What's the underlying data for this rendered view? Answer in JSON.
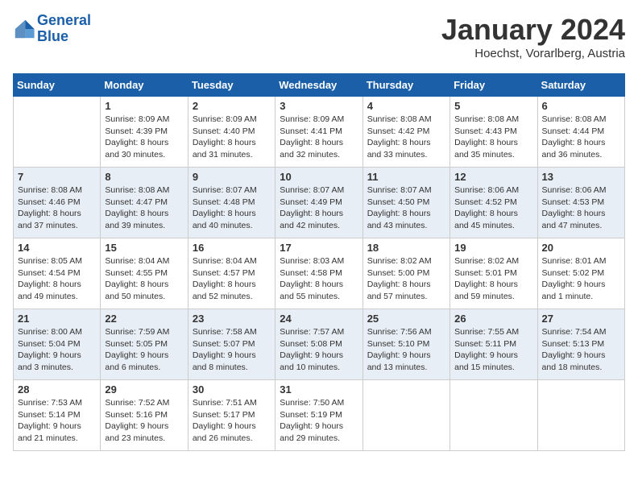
{
  "header": {
    "logo_line1": "General",
    "logo_line2": "Blue",
    "month": "January 2024",
    "location": "Hoechst, Vorarlberg, Austria"
  },
  "days_of_week": [
    "Sunday",
    "Monday",
    "Tuesday",
    "Wednesday",
    "Thursday",
    "Friday",
    "Saturday"
  ],
  "weeks": [
    [
      {
        "day": "",
        "info": ""
      },
      {
        "day": "1",
        "info": "Sunrise: 8:09 AM\nSunset: 4:39 PM\nDaylight: 8 hours\nand 30 minutes."
      },
      {
        "day": "2",
        "info": "Sunrise: 8:09 AM\nSunset: 4:40 PM\nDaylight: 8 hours\nand 31 minutes."
      },
      {
        "day": "3",
        "info": "Sunrise: 8:09 AM\nSunset: 4:41 PM\nDaylight: 8 hours\nand 32 minutes."
      },
      {
        "day": "4",
        "info": "Sunrise: 8:08 AM\nSunset: 4:42 PM\nDaylight: 8 hours\nand 33 minutes."
      },
      {
        "day": "5",
        "info": "Sunrise: 8:08 AM\nSunset: 4:43 PM\nDaylight: 8 hours\nand 35 minutes."
      },
      {
        "day": "6",
        "info": "Sunrise: 8:08 AM\nSunset: 4:44 PM\nDaylight: 8 hours\nand 36 minutes."
      }
    ],
    [
      {
        "day": "7",
        "info": "Sunrise: 8:08 AM\nSunset: 4:46 PM\nDaylight: 8 hours\nand 37 minutes."
      },
      {
        "day": "8",
        "info": "Sunrise: 8:08 AM\nSunset: 4:47 PM\nDaylight: 8 hours\nand 39 minutes."
      },
      {
        "day": "9",
        "info": "Sunrise: 8:07 AM\nSunset: 4:48 PM\nDaylight: 8 hours\nand 40 minutes."
      },
      {
        "day": "10",
        "info": "Sunrise: 8:07 AM\nSunset: 4:49 PM\nDaylight: 8 hours\nand 42 minutes."
      },
      {
        "day": "11",
        "info": "Sunrise: 8:07 AM\nSunset: 4:50 PM\nDaylight: 8 hours\nand 43 minutes."
      },
      {
        "day": "12",
        "info": "Sunrise: 8:06 AM\nSunset: 4:52 PM\nDaylight: 8 hours\nand 45 minutes."
      },
      {
        "day": "13",
        "info": "Sunrise: 8:06 AM\nSunset: 4:53 PM\nDaylight: 8 hours\nand 47 minutes."
      }
    ],
    [
      {
        "day": "14",
        "info": "Sunrise: 8:05 AM\nSunset: 4:54 PM\nDaylight: 8 hours\nand 49 minutes."
      },
      {
        "day": "15",
        "info": "Sunrise: 8:04 AM\nSunset: 4:55 PM\nDaylight: 8 hours\nand 50 minutes."
      },
      {
        "day": "16",
        "info": "Sunrise: 8:04 AM\nSunset: 4:57 PM\nDaylight: 8 hours\nand 52 minutes."
      },
      {
        "day": "17",
        "info": "Sunrise: 8:03 AM\nSunset: 4:58 PM\nDaylight: 8 hours\nand 55 minutes."
      },
      {
        "day": "18",
        "info": "Sunrise: 8:02 AM\nSunset: 5:00 PM\nDaylight: 8 hours\nand 57 minutes."
      },
      {
        "day": "19",
        "info": "Sunrise: 8:02 AM\nSunset: 5:01 PM\nDaylight: 8 hours\nand 59 minutes."
      },
      {
        "day": "20",
        "info": "Sunrise: 8:01 AM\nSunset: 5:02 PM\nDaylight: 9 hours\nand 1 minute."
      }
    ],
    [
      {
        "day": "21",
        "info": "Sunrise: 8:00 AM\nSunset: 5:04 PM\nDaylight: 9 hours\nand 3 minutes."
      },
      {
        "day": "22",
        "info": "Sunrise: 7:59 AM\nSunset: 5:05 PM\nDaylight: 9 hours\nand 6 minutes."
      },
      {
        "day": "23",
        "info": "Sunrise: 7:58 AM\nSunset: 5:07 PM\nDaylight: 9 hours\nand 8 minutes."
      },
      {
        "day": "24",
        "info": "Sunrise: 7:57 AM\nSunset: 5:08 PM\nDaylight: 9 hours\nand 10 minutes."
      },
      {
        "day": "25",
        "info": "Sunrise: 7:56 AM\nSunset: 5:10 PM\nDaylight: 9 hours\nand 13 minutes."
      },
      {
        "day": "26",
        "info": "Sunrise: 7:55 AM\nSunset: 5:11 PM\nDaylight: 9 hours\nand 15 minutes."
      },
      {
        "day": "27",
        "info": "Sunrise: 7:54 AM\nSunset: 5:13 PM\nDaylight: 9 hours\nand 18 minutes."
      }
    ],
    [
      {
        "day": "28",
        "info": "Sunrise: 7:53 AM\nSunset: 5:14 PM\nDaylight: 9 hours\nand 21 minutes."
      },
      {
        "day": "29",
        "info": "Sunrise: 7:52 AM\nSunset: 5:16 PM\nDaylight: 9 hours\nand 23 minutes."
      },
      {
        "day": "30",
        "info": "Sunrise: 7:51 AM\nSunset: 5:17 PM\nDaylight: 9 hours\nand 26 minutes."
      },
      {
        "day": "31",
        "info": "Sunrise: 7:50 AM\nSunset: 5:19 PM\nDaylight: 9 hours\nand 29 minutes."
      },
      {
        "day": "",
        "info": ""
      },
      {
        "day": "",
        "info": ""
      },
      {
        "day": "",
        "info": ""
      }
    ]
  ]
}
